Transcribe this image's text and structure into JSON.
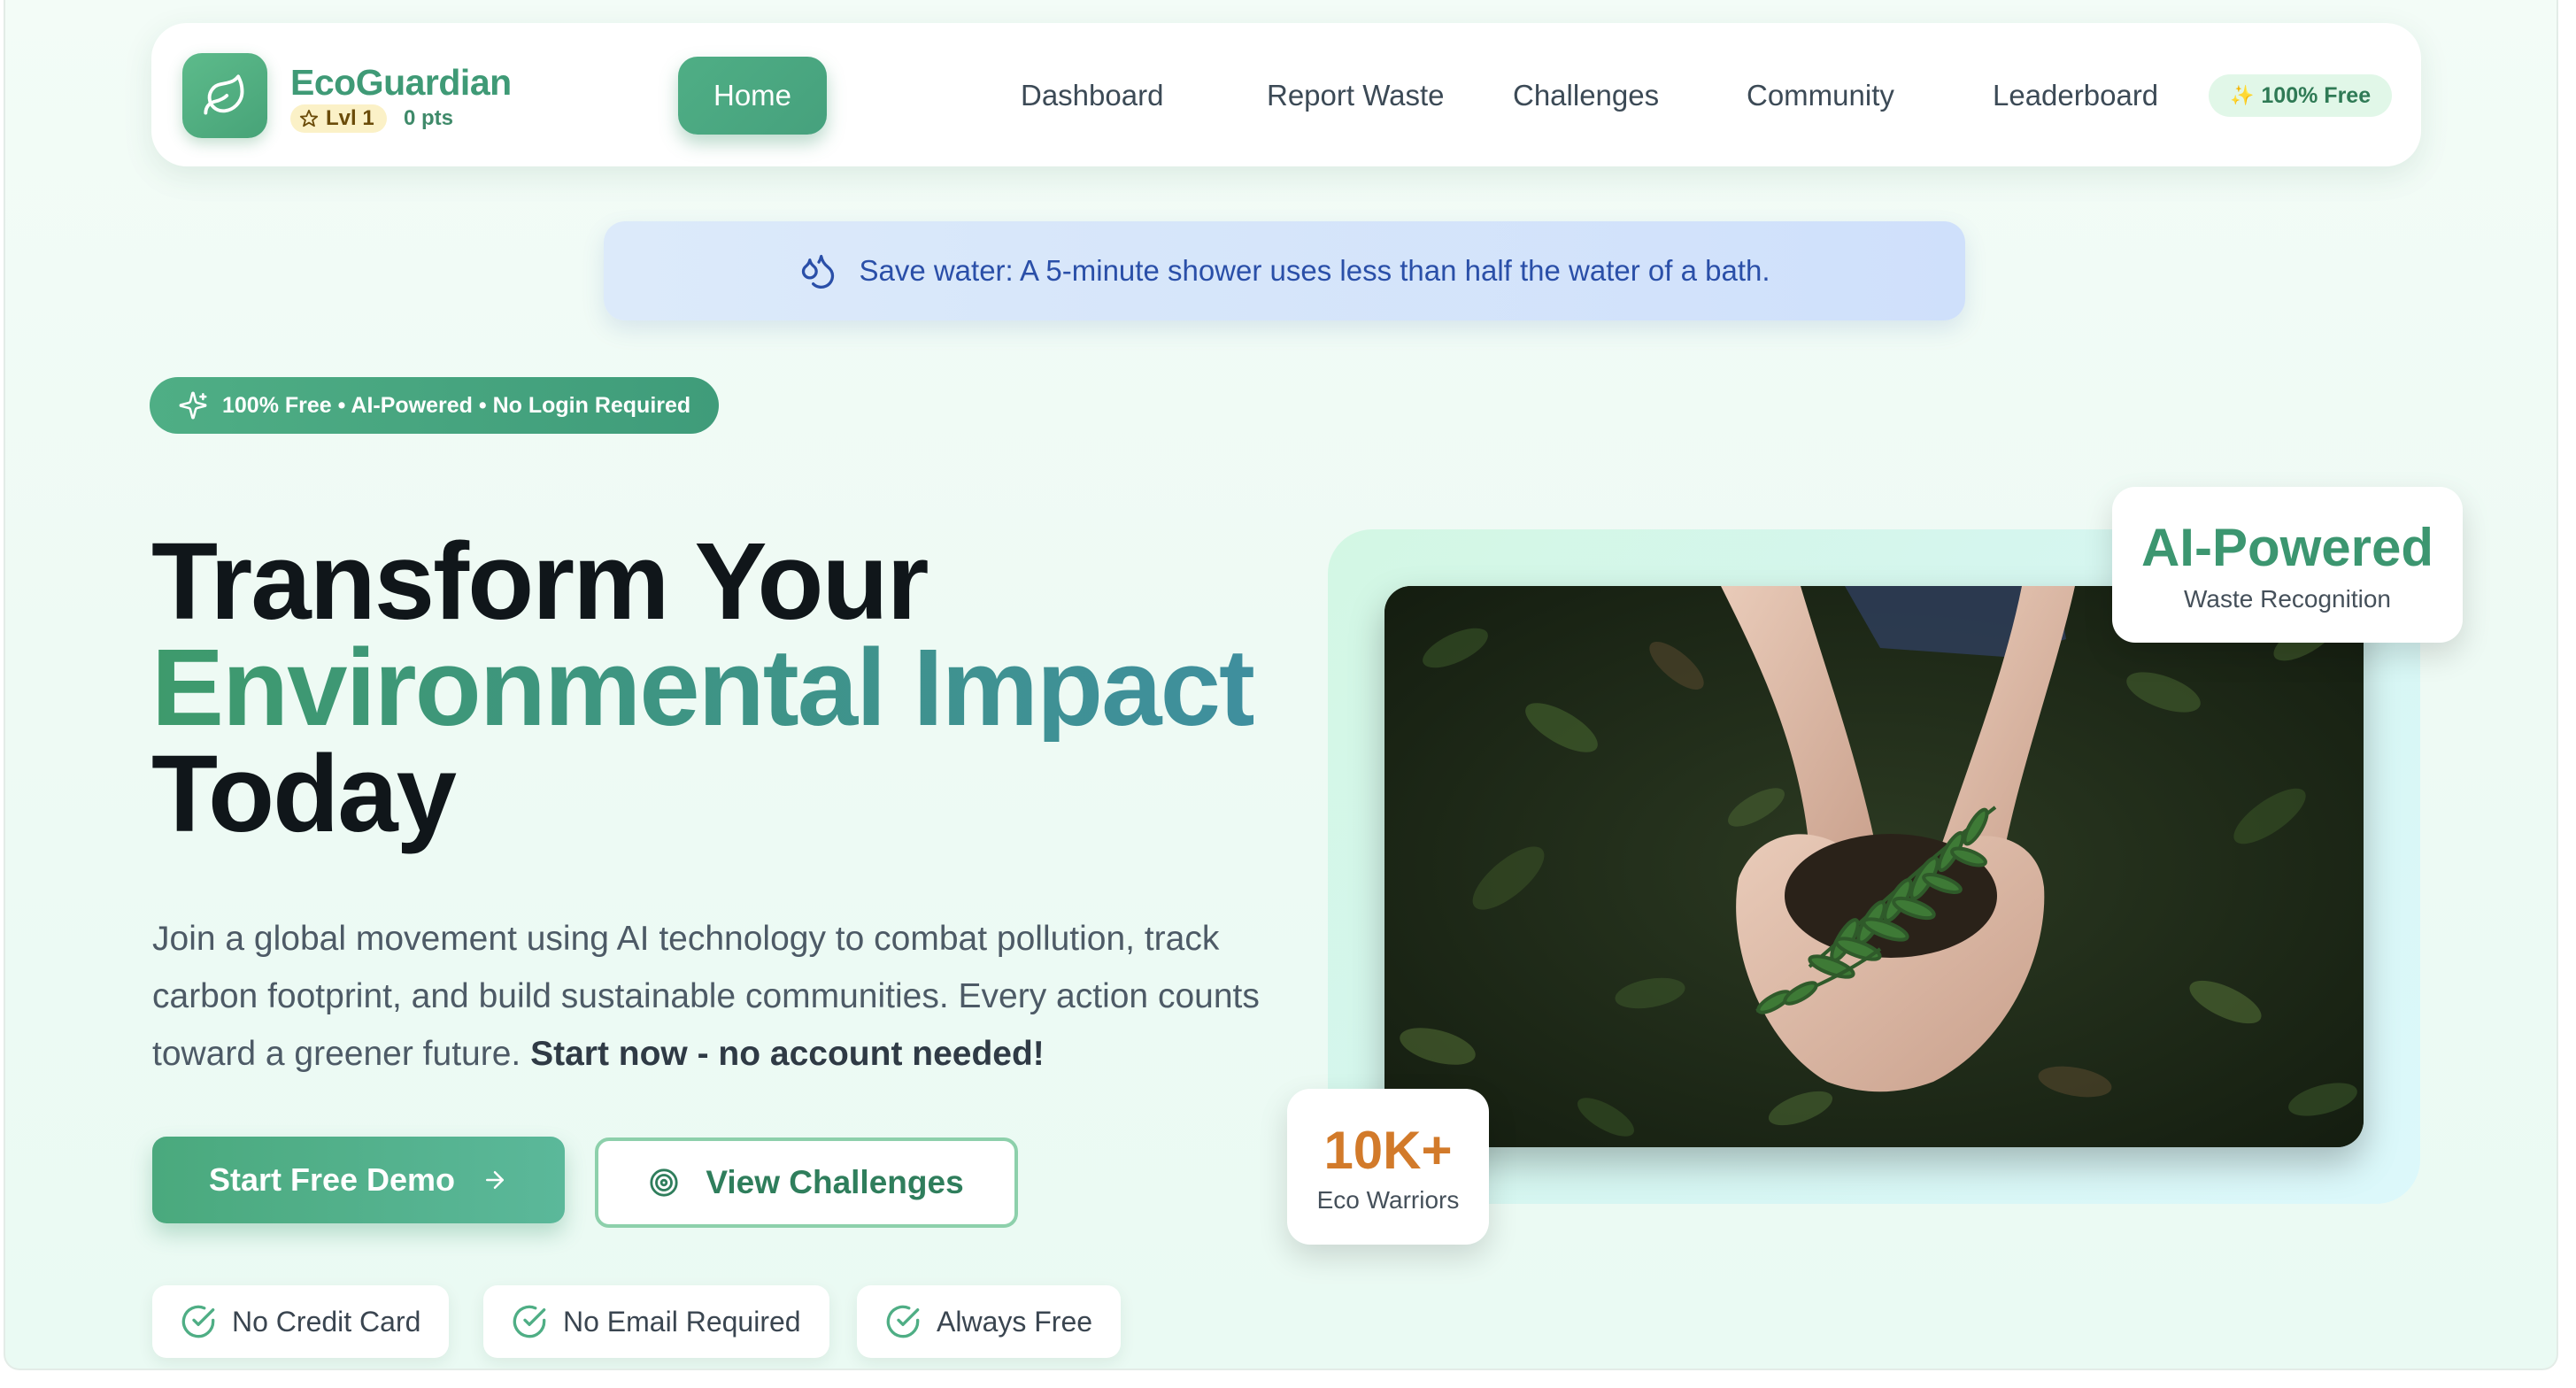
{
  "nav": {
    "brand": "EcoGuardian",
    "level": "Lvl 1",
    "points": "0 pts",
    "items": [
      "Home",
      "Dashboard",
      "Report Waste",
      "Challenges",
      "Community",
      "Leaderboard"
    ],
    "active": "Home",
    "free_badge": "100% Free"
  },
  "tip": {
    "icon": "droplets-icon",
    "text": "Save water: A 5-minute shower uses less than half the water of a bath."
  },
  "hero": {
    "badge": "100% Free • AI-Powered • No Login Required",
    "title_line1": "Transform Your",
    "title_line2": "Environmental Impact",
    "title_line3": "Today",
    "lead": "Join a global movement using AI technology to combat pollution, track carbon footprint, and build sustainable communities. Every action counts toward a greener future.",
    "lead_strong": "Start now - no account needed!",
    "primary_button": "Start Free Demo",
    "secondary_button": "View Challenges",
    "perks": [
      "No Credit Card",
      "No Email Required",
      "Always Free"
    ]
  },
  "media": {
    "ai_card_title": "AI-Powered",
    "ai_card_sub": "Waste Recognition",
    "stat_value": "10K+",
    "stat_label": "Eco Warriors"
  },
  "colors": {
    "brand_green": "#4fae85",
    "gradient_teal": "#3f8f9e",
    "tip_blue": "#2a4fa8",
    "stat_orange": "#d27a2a"
  }
}
